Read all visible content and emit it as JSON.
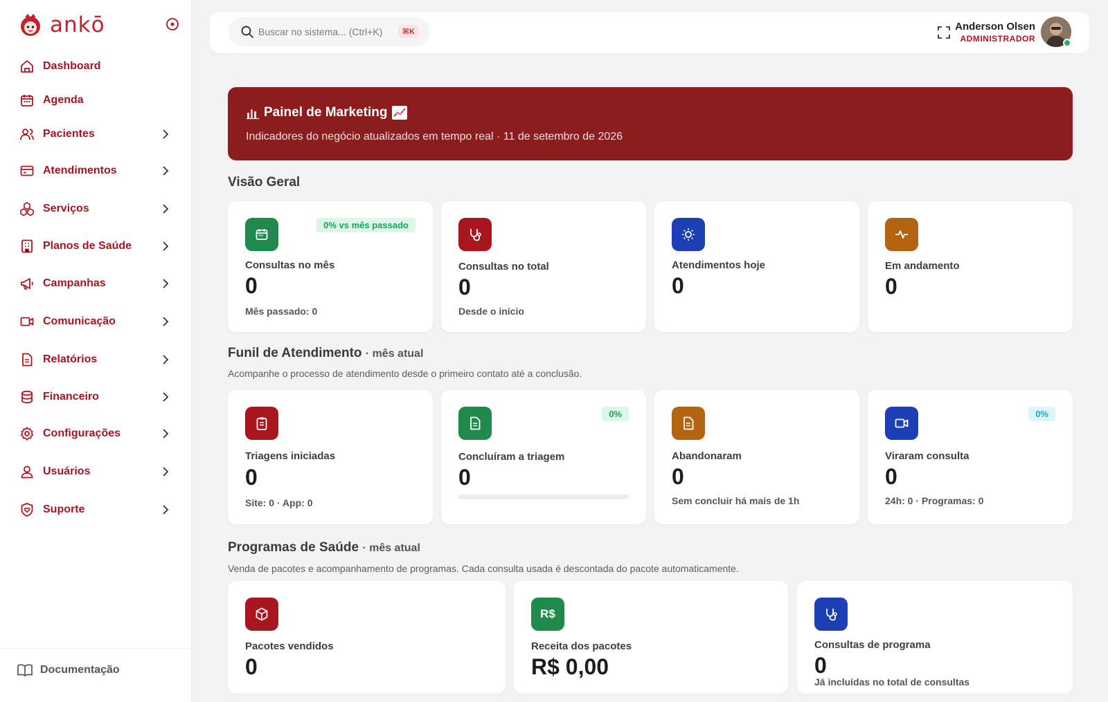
{
  "app": {
    "logo_text": "ankō"
  },
  "sidebar": {
    "items": [
      {
        "label": "Dashboard",
        "icon": "home-icon",
        "has_children": false
      },
      {
        "label": "Agenda",
        "icon": "calendar-icon",
        "has_children": false
      },
      {
        "label": "Pacientes",
        "icon": "users-icon",
        "has_children": true
      },
      {
        "label": "Atendimentos",
        "icon": "card-icon",
        "has_children": true
      },
      {
        "label": "Serviços",
        "icon": "boxes-icon",
        "has_children": true
      },
      {
        "label": "Planos de Saúde",
        "icon": "building-icon",
        "has_children": true
      },
      {
        "label": "Campanhas",
        "icon": "megaphone-icon",
        "has_children": true
      },
      {
        "label": "Comunicação",
        "icon": "video-icon",
        "has_children": true
      },
      {
        "label": "Relatórios",
        "icon": "document-icon",
        "has_children": true
      },
      {
        "label": "Financeiro",
        "icon": "coins-icon",
        "has_children": true
      },
      {
        "label": "Configurações",
        "icon": "gear-icon",
        "has_children": true
      },
      {
        "label": "Usuários",
        "icon": "user-icon",
        "has_children": true
      },
      {
        "label": "Suporte",
        "icon": "shield-heart-icon",
        "has_children": true
      }
    ],
    "footer_label": "Documentação"
  },
  "topbar": {
    "search_placeholder": "Buscar no sistema... (Ctrl+K)",
    "search_shortcut": "⌘K",
    "user_name": "Anderson Olsen",
    "user_role": "ADMINISTRADOR"
  },
  "banner": {
    "title": "Painel de Marketing",
    "subtitle": "Indicadores do negócio atualizados em tempo real · 11 de setembro de 2026"
  },
  "overview": {
    "title": "Visão Geral",
    "cards": [
      {
        "label": "Consultas no mês",
        "value": "0",
        "sub": "Mês passado: 0",
        "badge": "0% vs mês passado",
        "icon": "calendar-icon"
      },
      {
        "label": "Consultas no total",
        "value": "0",
        "sub": "Desde o início",
        "icon": "stethoscope-icon"
      },
      {
        "label": "Atendimentos hoje",
        "value": "0",
        "icon": "sun-icon"
      },
      {
        "label": "Em andamento",
        "value": "0",
        "icon": "pulse-icon"
      }
    ]
  },
  "funnel": {
    "title": "Funil de Atendimento",
    "suffix": "· mês atual",
    "description": "Acompanhe o processo de atendimento desde o primeiro contato até a conclusão.",
    "cards": [
      {
        "label": "Triagens iniciadas",
        "value": "0",
        "sub": "Site: 0 · App: 0",
        "icon": "clipboard-icon"
      },
      {
        "label": "Concluíram a triagem",
        "value": "0",
        "badge": "0%",
        "progress": 0,
        "icon": "file-text-icon"
      },
      {
        "label": "Abandonaram",
        "value": "0",
        "sub": "Sem concluir há mais de 1h",
        "icon": "file-icon"
      },
      {
        "label": "Viraram consulta",
        "value": "0",
        "sub": "24h: 0 · Programas: 0",
        "badge": "0%",
        "icon": "video-icon"
      }
    ]
  },
  "programs": {
    "title": "Programas de Saúde",
    "suffix": "· mês atual",
    "description": "Venda de pacotes e acompanhamento de programas. Cada consulta usada é descontada do pacote automaticamente.",
    "cards": [
      {
        "label": "Pacotes vendidos",
        "value": "0",
        "icon": "box-icon"
      },
      {
        "label": "Receita dos pacotes",
        "value": "R$ 0,00",
        "icon_text": "R$"
      },
      {
        "label": "Consultas de programa",
        "value": "0",
        "sub": "Já incluídas no total de consultas",
        "icon": "stethoscope-icon"
      }
    ]
  },
  "colors": {
    "brand": "#a4161f",
    "banner": "#8c1d1f",
    "green": "#1f8a4c",
    "blue": "#1d3fb5",
    "orange": "#b26411"
  }
}
